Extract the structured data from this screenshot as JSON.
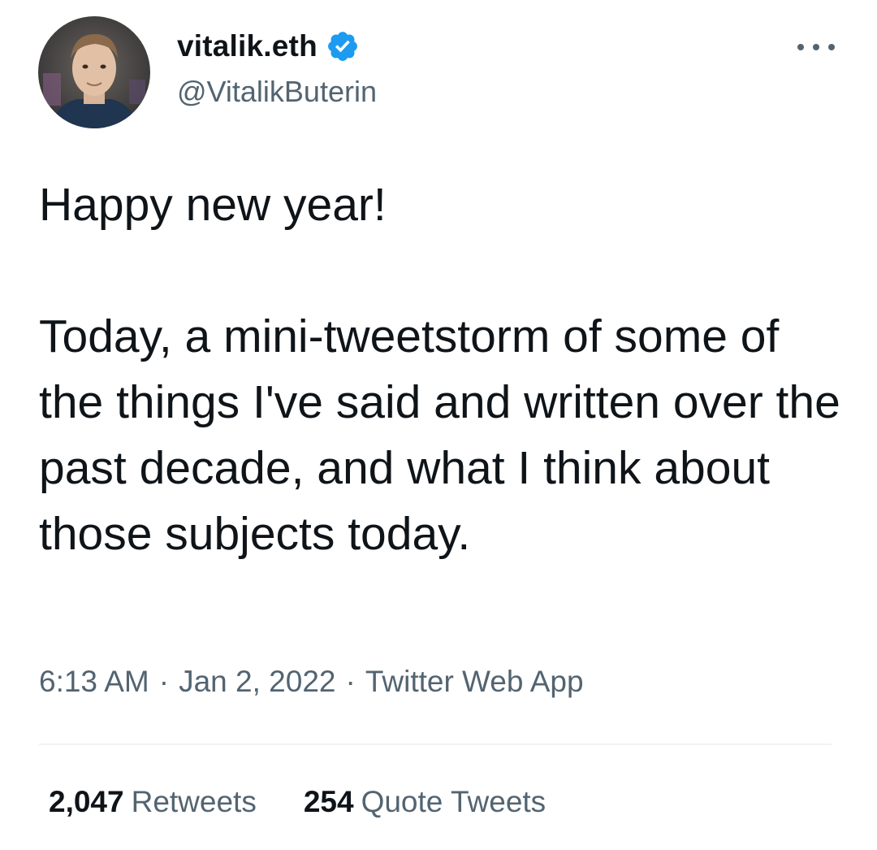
{
  "author": {
    "display_name": "vitalik.eth",
    "handle": "@VitalikButerin",
    "verified": true,
    "avatar_icon": "profile-photo"
  },
  "menu_icon": "more-options-icon",
  "tweet": {
    "paragraphs": [
      "Happy new year!",
      "Today, a mini-tweetstorm of some of the things I've said and written over the past decade, and what I think about those subjects today."
    ],
    "time": "6:13 AM",
    "date": "Jan 2, 2022",
    "source": "Twitter Web App",
    "separator": "·"
  },
  "stats": {
    "retweets_count": "2,047",
    "retweets_label": "Retweets",
    "quotes_count": "254",
    "quotes_label": "Quote Tweets"
  },
  "colors": {
    "text_primary": "#0f1419",
    "text_secondary": "#536471",
    "verified_blue": "#1d9bf0",
    "divider": "#eff3f4"
  }
}
